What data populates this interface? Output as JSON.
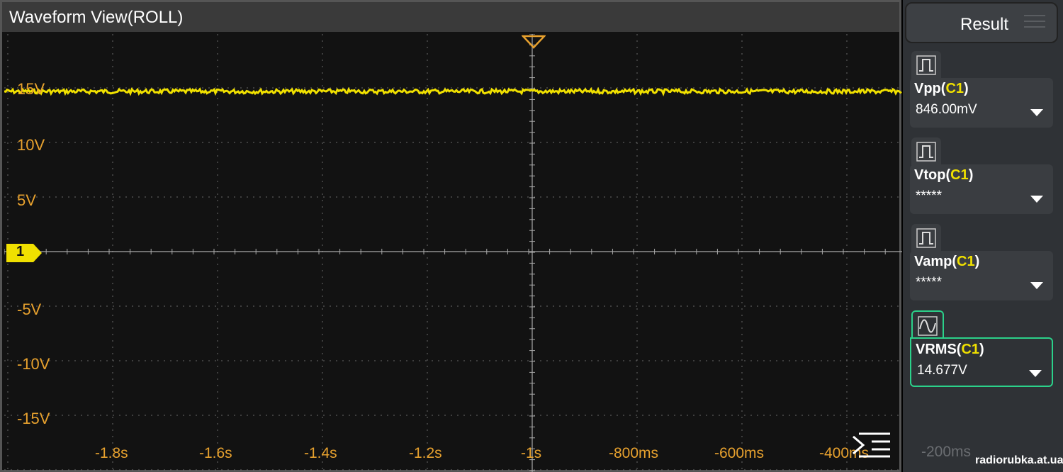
{
  "waveform": {
    "title": "Waveform View(ROLL)",
    "channel_marker": "1",
    "trace_color": "#f0e000",
    "y_labels": [
      "15V",
      "10V",
      "5V",
      "-5V",
      "-10V",
      "-15V"
    ],
    "x_labels": [
      "-1.8s",
      "-1.6s",
      "-1.4s",
      "-1.2s",
      "-1s",
      "-800ms",
      "-600ms",
      "-400ms"
    ],
    "trace_level_v": 14.677,
    "menu_icon": "menu-collapse-icon"
  },
  "result": {
    "title": "Result",
    "measurements": [
      {
        "name": "Vpp",
        "channel": "C1",
        "value": "846.00mV",
        "icon": "pulse-icon"
      },
      {
        "name": "Vtop",
        "channel": "C1",
        "value": "*****",
        "icon": "pulse-icon"
      },
      {
        "name": "Vamp",
        "channel": "C1",
        "value": "*****",
        "icon": "pulse-icon"
      },
      {
        "name": "VRMS",
        "channel": "C1",
        "value": "14.677V",
        "icon": "sine-wave-icon"
      }
    ]
  },
  "overlay_time_label": "-200ms",
  "watermark": "radiorubka.at.ua",
  "colors": {
    "accent": "#e7a12e",
    "active": "#2bd18a",
    "channel": "#f0e000"
  }
}
